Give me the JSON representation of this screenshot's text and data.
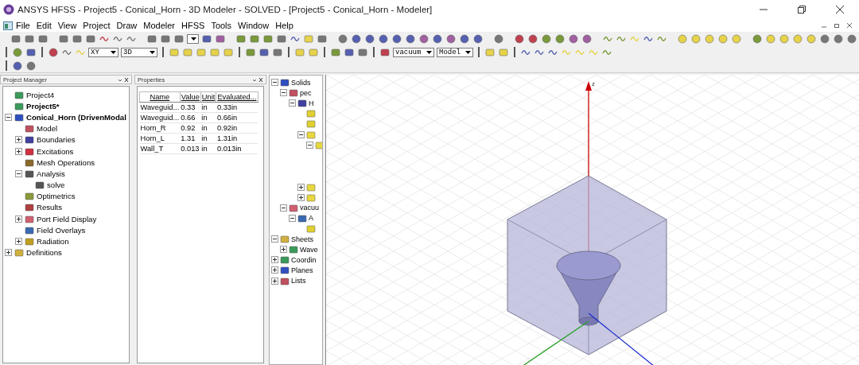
{
  "window": {
    "title": "ANSYS HFSS - Project5 - Conical_Horn - 3D Modeler - SOLVED - [Project5 - Conical_Horn - Modeler]"
  },
  "menu": [
    "File",
    "Edit",
    "View",
    "Project",
    "Draw",
    "Modeler",
    "HFSS",
    "Tools",
    "Window",
    "Help"
  ],
  "toolbar": {
    "plane": "XY",
    "dimension": "3D",
    "material": "vacuum",
    "mode": "Model"
  },
  "project_manager": {
    "title": "Project Manager",
    "items": [
      {
        "label": "Project4",
        "active": false
      },
      {
        "label": "Project5*",
        "active": true
      },
      {
        "label": "Conical_Horn (DrivenModal",
        "active": true,
        "expanded": true,
        "children": [
          {
            "label": "Model",
            "active": false
          },
          {
            "label": "Boundaries",
            "active": false,
            "expanded": false
          },
          {
            "label": "Excitations",
            "active": false,
            "expanded": false
          },
          {
            "label": "Mesh Operations",
            "active": false
          },
          {
            "label": "Analysis",
            "active": false,
            "expanded": true,
            "children": [
              {
                "label": "solve",
                "active": false
              }
            ]
          },
          {
            "label": "Optimetrics",
            "active": false
          },
          {
            "label": "Results",
            "active": false
          },
          {
            "label": "Port Field Display",
            "active": false,
            "expanded": false
          },
          {
            "label": "Field Overlays",
            "active": false
          },
          {
            "label": "Radiation",
            "active": false,
            "expanded": false
          }
        ]
      },
      {
        "label": "Definitions",
        "active": false,
        "expanded": false
      }
    ]
  },
  "properties": {
    "title": "Properties",
    "columns": [
      "Name",
      "Value",
      "Unit",
      "Evaluated..."
    ],
    "rows": [
      [
        "Waveguid...",
        "0.33",
        "in",
        "0.33in"
      ],
      [
        "Waveguid...",
        "0.66",
        "in",
        "0.66in"
      ],
      [
        "Horn_R",
        "0.92",
        "in",
        "0.92in"
      ],
      [
        "Horn_L",
        "1.31",
        "in",
        "1.31in"
      ],
      [
        "Wall_T",
        "0.013",
        "in",
        "0.013in"
      ]
    ]
  },
  "model_tree": [
    {
      "label": "Solids",
      "expanded": true,
      "children": [
        {
          "label": "pec",
          "expanded": true,
          "children": [
            {
              "label": "H",
              "expanded": true,
              "children": [
                {
                  "kind": "icon"
                },
                {
                  "kind": "icon"
                },
                {
                  "expanded": true,
                  "children": [
                    {
                      "expanded": true
                    }
                  ]
                },
                {
                  "expanded": false
                },
                {
                  "expanded": false
                }
              ]
            }
          ]
        },
        {
          "label": "vacuu",
          "expanded": true,
          "children": [
            {
              "label": "A",
              "expanded": true,
              "children": [
                {
                  "kind": "icon"
                }
              ]
            }
          ]
        }
      ]
    },
    {
      "label": "Sheets",
      "expanded": true,
      "children": [
        {
          "label": "Wave",
          "expanded": false
        }
      ]
    },
    {
      "label": "Coordin",
      "expanded": false
    },
    {
      "label": "Planes",
      "expanded": false
    },
    {
      "label": "Lists",
      "expanded": false
    }
  ],
  "view": {
    "axis_label": "z"
  }
}
